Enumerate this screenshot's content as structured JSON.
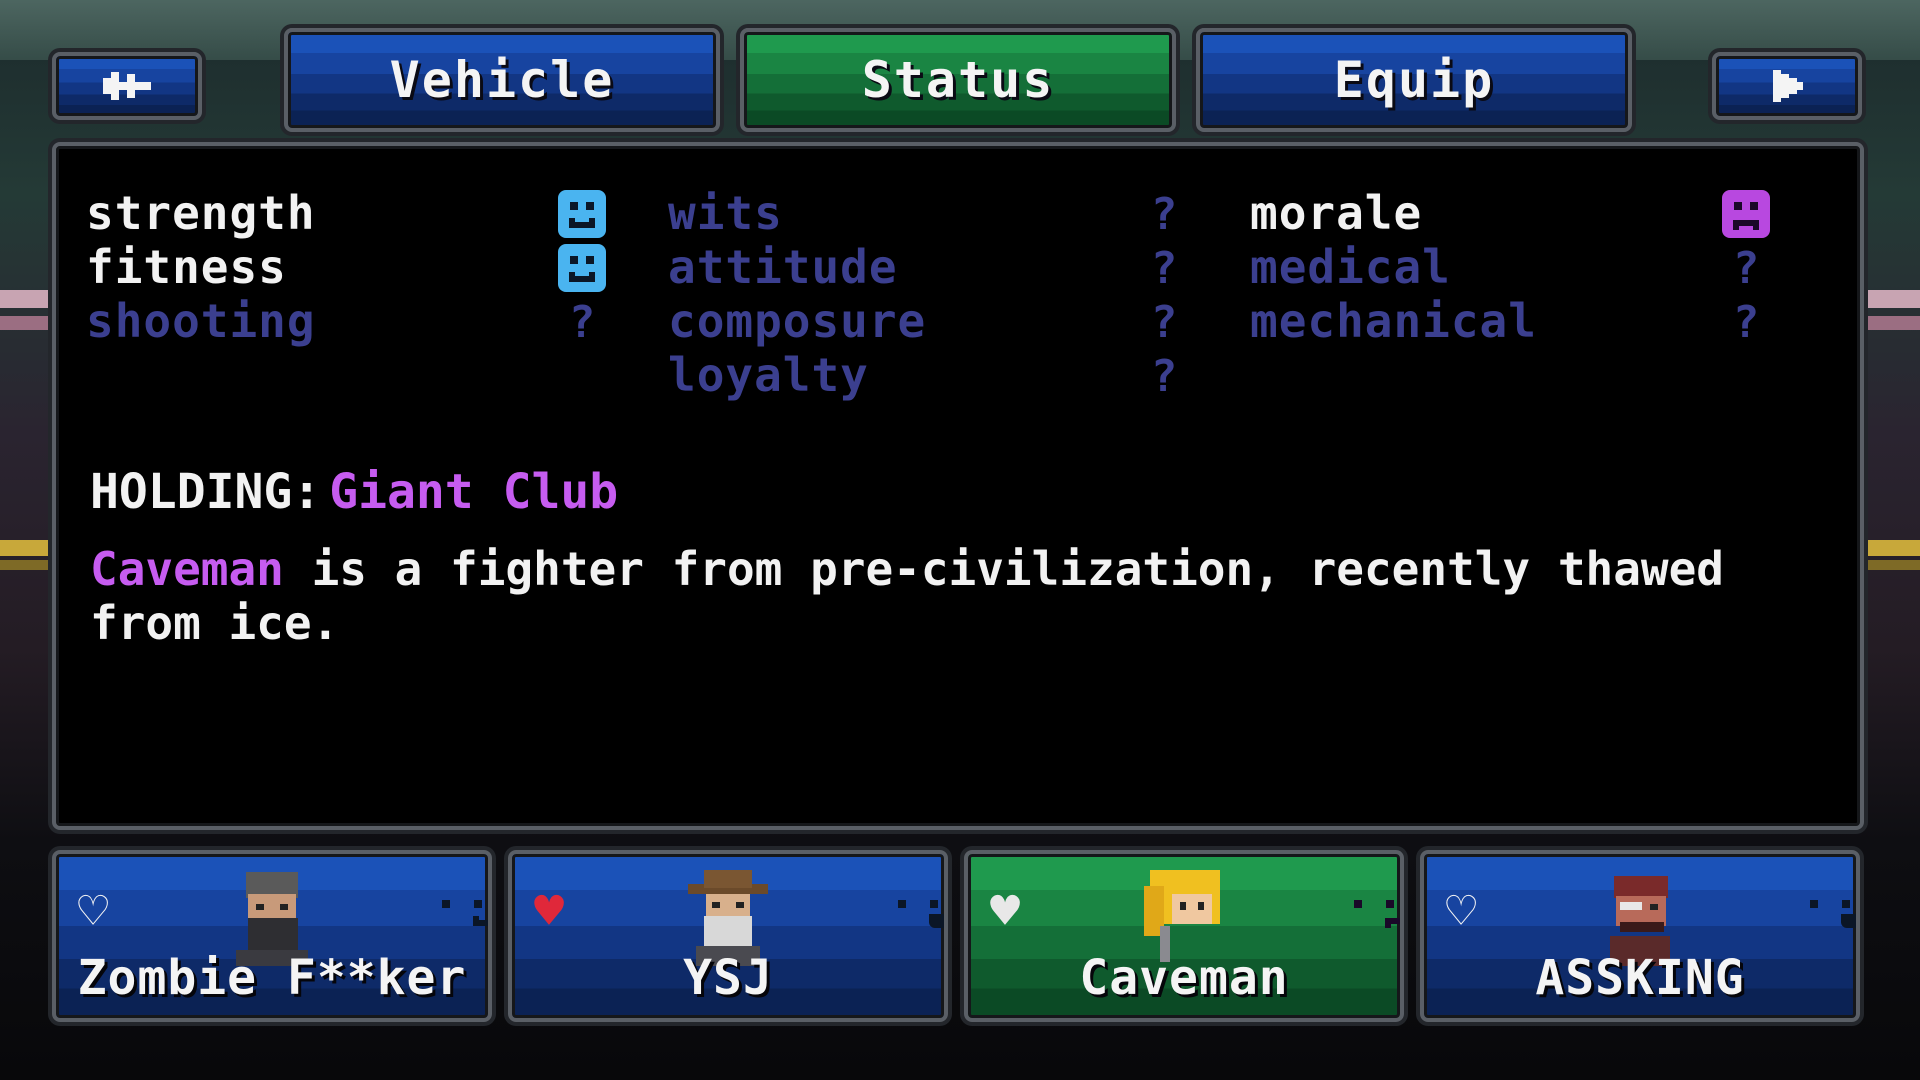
{
  "top_bar": {
    "back_icon": "back-arrow-icon",
    "next_icon": "play-arrow-icon",
    "tabs": [
      {
        "label": "Vehicle",
        "active": false
      },
      {
        "label": "Status",
        "active": true
      },
      {
        "label": "Equip",
        "active": false
      }
    ]
  },
  "stats": {
    "column1": [
      {
        "name": "strength",
        "known": true,
        "value": "smile",
        "color": "#4ab4f0"
      },
      {
        "name": "fitness",
        "known": true,
        "value": "smile",
        "color": "#4ab4f0"
      },
      {
        "name": "shooting",
        "known": false,
        "value": "?"
      }
    ],
    "column2": [
      {
        "name": "wits",
        "known": false,
        "value": "?"
      },
      {
        "name": "attitude",
        "known": false,
        "value": "?"
      },
      {
        "name": "composure",
        "known": false,
        "value": "?"
      },
      {
        "name": "loyalty",
        "known": false,
        "value": "?"
      }
    ],
    "column3": [
      {
        "name": "morale",
        "known": true,
        "value": "frown",
        "color": "#b848e0"
      },
      {
        "name": "medical",
        "known": false,
        "value": "?"
      },
      {
        "name": "mechanical",
        "known": false,
        "value": "?"
      }
    ]
  },
  "holding": {
    "label": "HOLDING:",
    "item": "Giant Club"
  },
  "description": {
    "name": "Caveman",
    "text": " is a fighter from pre-civilization, recently thawed from ice."
  },
  "party": [
    {
      "name": "Zombie F**ker",
      "heart": "empty",
      "mood": "smile",
      "mood_color": "#4ab4f0",
      "selected": false
    },
    {
      "name": "YSJ",
      "heart": "full",
      "mood": "grin",
      "mood_color": "#3ad86a",
      "selected": false
    },
    {
      "name": "Caveman",
      "heart": "half",
      "mood": "frown",
      "mood_color": "#b848e0",
      "selected": true
    },
    {
      "name": "ASSKING",
      "heart": "empty",
      "mood": "grin",
      "mood_color": "#3ad8a0",
      "selected": false
    }
  ],
  "colors": {
    "tab_blue": "#1b52b8",
    "tab_green": "#1f9a4e",
    "unknown_stat": "#3b3f8f",
    "highlight_purple": "#c65cf0"
  }
}
